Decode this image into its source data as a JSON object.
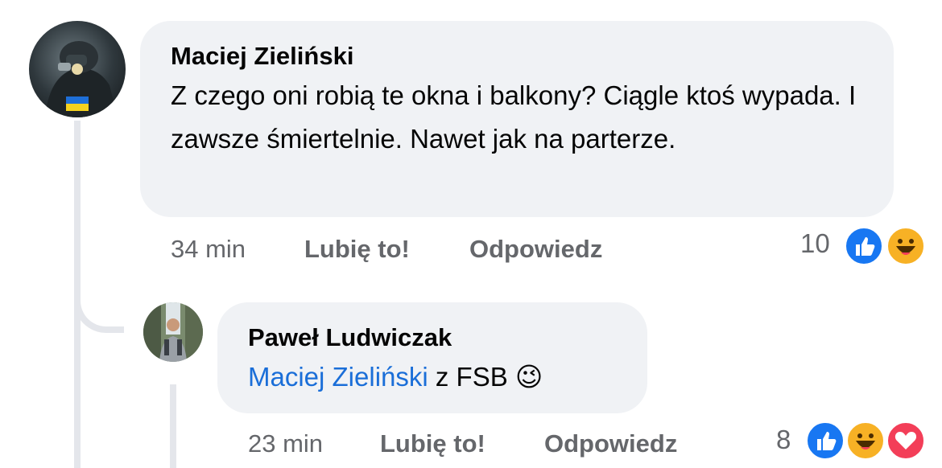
{
  "comments": [
    {
      "author": "Maciej Zieliński",
      "text": "Z czego oni robią te okna i balkony? Ciągle ktoś wypada. I zawsze śmiertelnie. Nawet jak na parterze.",
      "time": "34 min",
      "like_label": "Lubię to!",
      "reply_label": "Odpowiedz",
      "reaction_count": "10",
      "reactions": [
        "like-icon",
        "haha-icon"
      ]
    },
    {
      "author": "Paweł Ludwiczak",
      "mention": "Maciej Zieliński",
      "text": "z FSB",
      "emoji": "😉",
      "time": "23 min",
      "like_label": "Lubię to!",
      "reply_label": "Odpowiedz",
      "reaction_count": "8",
      "reactions": [
        "like-icon",
        "haha-icon",
        "love-icon"
      ]
    }
  ],
  "colors": {
    "bubble": "#f0f2f5",
    "meta": "#65676b",
    "mention": "#1a6ed8",
    "like": "#1877f2",
    "haha": "#f7b125",
    "love": "#f33e58"
  }
}
